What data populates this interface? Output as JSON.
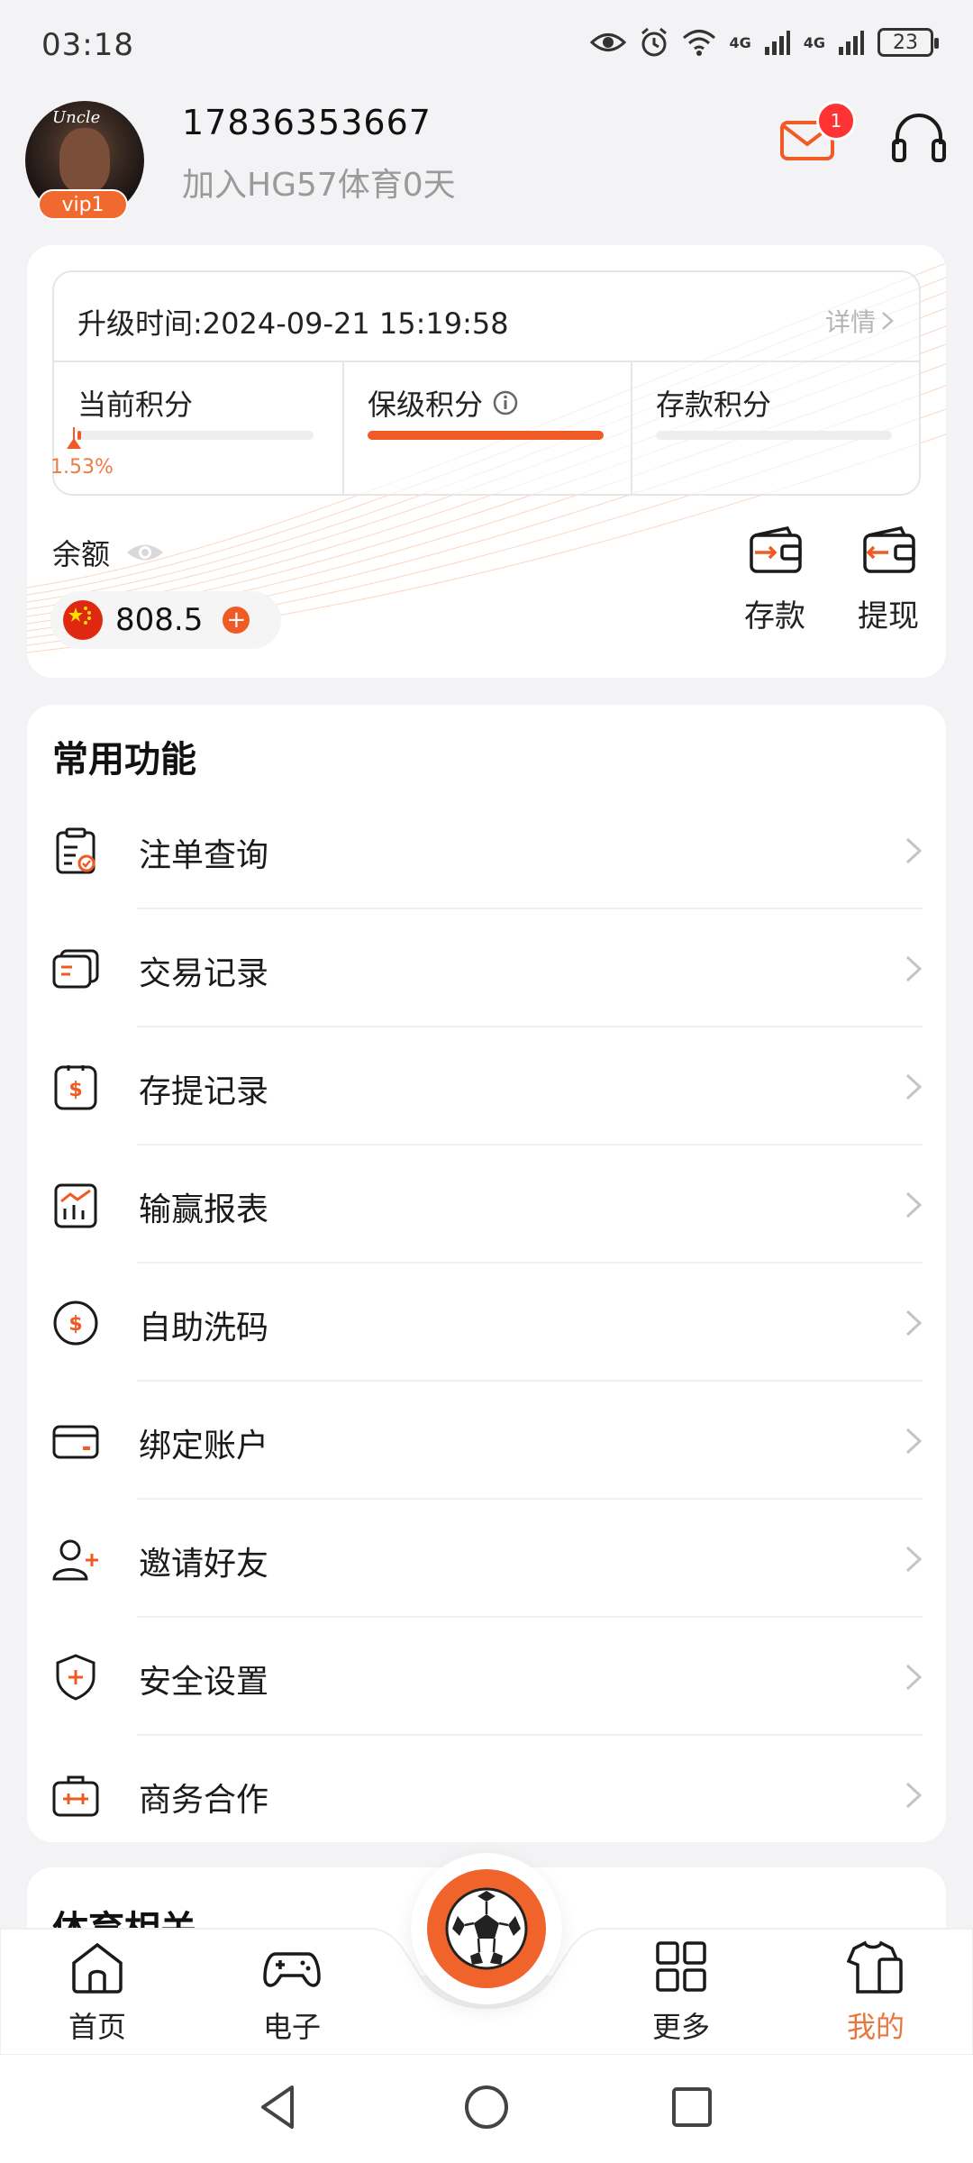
{
  "status_bar": {
    "time": "03:18",
    "network_1": "4G",
    "network_2": "4G",
    "battery": "23"
  },
  "profile": {
    "avatar_caption": "Uncle",
    "vip_level": "vip1",
    "phone": "17836353667",
    "join_text": "加入HG57体育0天",
    "unread_messages": "1"
  },
  "account": {
    "upgrade_time": "升级时间:2024-09-21 15:19:58",
    "detail_link": "详情",
    "points": [
      {
        "label": "当前积分",
        "progress": 0.0153,
        "percent_text": "1.53%"
      },
      {
        "label": "保级积分",
        "progress": 1.0
      },
      {
        "label": "存款积分",
        "progress": 0
      }
    ],
    "balance_label": "余额",
    "balance_amount": "808.5",
    "deposit_label": "存款",
    "withdraw_label": "提现",
    "accent_color": "#f05a24"
  },
  "functions": {
    "title": "常用功能",
    "items": [
      {
        "label": "注单查询",
        "icon": "clipboard-check-icon"
      },
      {
        "label": "交易记录",
        "icon": "cards-icon"
      },
      {
        "label": "存提记录",
        "icon": "dollar-card-icon"
      },
      {
        "label": "输赢报表",
        "icon": "chart-report-icon"
      },
      {
        "label": "自助洗码",
        "icon": "dollar-coin-icon"
      },
      {
        "label": "绑定账户",
        "icon": "credit-card-icon"
      },
      {
        "label": "邀请好友",
        "icon": "add-user-icon"
      },
      {
        "label": "安全设置",
        "icon": "shield-plus-icon"
      },
      {
        "label": "商务合作",
        "icon": "briefcase-icon"
      }
    ]
  },
  "sports": {
    "title": "体育相关"
  },
  "bottom_nav": {
    "home": "首页",
    "electronic": "电子",
    "more": "更多",
    "mine": "我的",
    "active": "mine"
  }
}
